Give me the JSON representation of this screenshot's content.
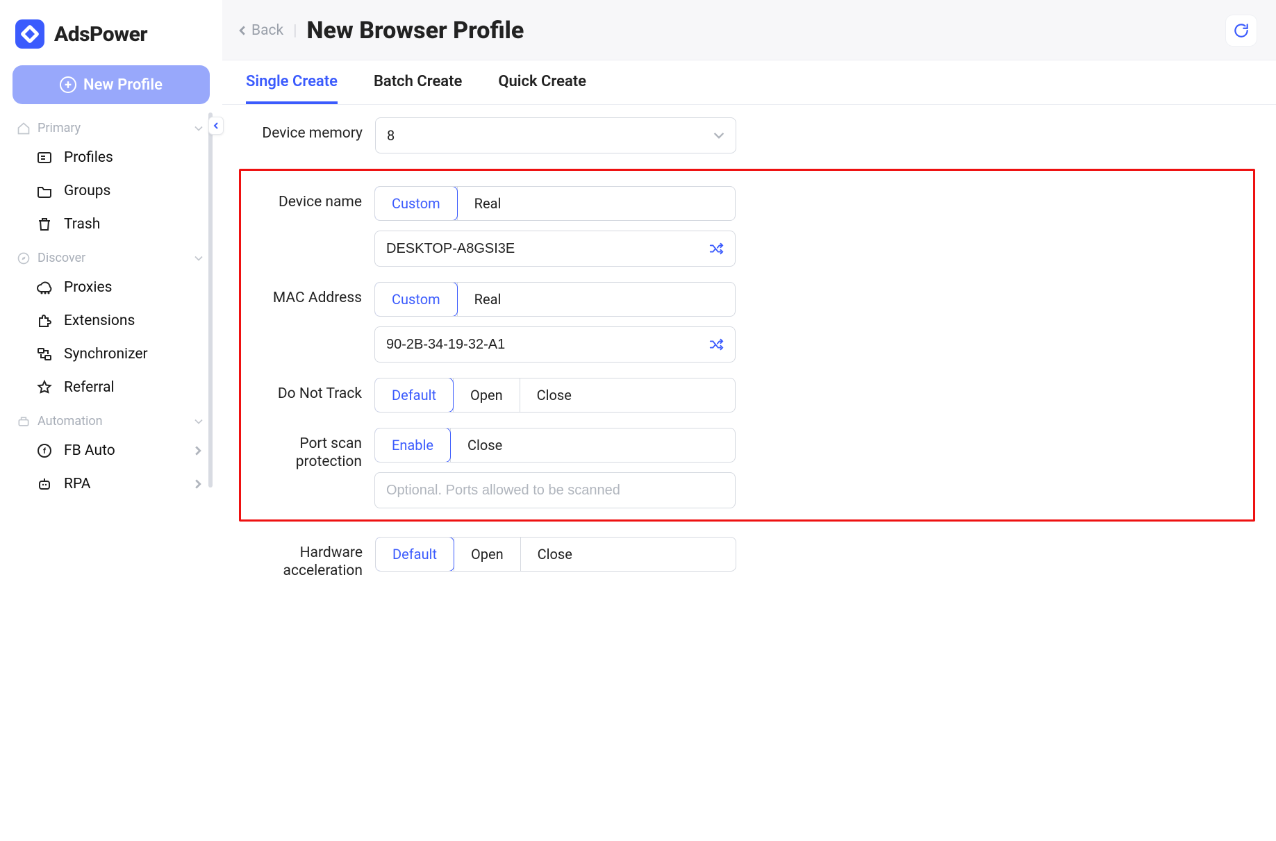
{
  "app": {
    "name": "AdsPower"
  },
  "sidebar": {
    "new_profile_label": "New Profile",
    "sections": {
      "primary": {
        "title": "Primary",
        "items": [
          {
            "label": "Profiles"
          },
          {
            "label": "Groups"
          },
          {
            "label": "Trash"
          }
        ]
      },
      "discover": {
        "title": "Discover",
        "items": [
          {
            "label": "Proxies"
          },
          {
            "label": "Extensions"
          },
          {
            "label": "Synchronizer"
          },
          {
            "label": "Referral"
          }
        ]
      },
      "automation": {
        "title": "Automation",
        "items": [
          {
            "label": "FB Auto"
          },
          {
            "label": "RPA"
          }
        ]
      }
    }
  },
  "header": {
    "back_label": "Back",
    "page_title": "New Browser Profile"
  },
  "tabs": [
    {
      "label": "Single Create",
      "active": true
    },
    {
      "label": "Batch Create",
      "active": false
    },
    {
      "label": "Quick Create",
      "active": false
    }
  ],
  "form": {
    "device_memory": {
      "label": "Device memory",
      "value": "8"
    },
    "device_name": {
      "label": "Device name",
      "options": [
        "Custom",
        "Real"
      ],
      "active": "Custom",
      "value": "DESKTOP-A8GSI3E"
    },
    "mac_address": {
      "label": "MAC Address",
      "options": [
        "Custom",
        "Real"
      ],
      "active": "Custom",
      "value": "90-2B-34-19-32-A1"
    },
    "do_not_track": {
      "label": "Do Not Track",
      "options": [
        "Default",
        "Open",
        "Close"
      ],
      "active": "Default"
    },
    "port_scan": {
      "label": "Port scan protection",
      "options": [
        "Enable",
        "Close"
      ],
      "active": "Enable",
      "placeholder": "Optional. Ports allowed to be scanned"
    },
    "hardware_accel": {
      "label": "Hardware acceleration",
      "options": [
        "Default",
        "Open",
        "Close"
      ],
      "active": "Default"
    }
  }
}
